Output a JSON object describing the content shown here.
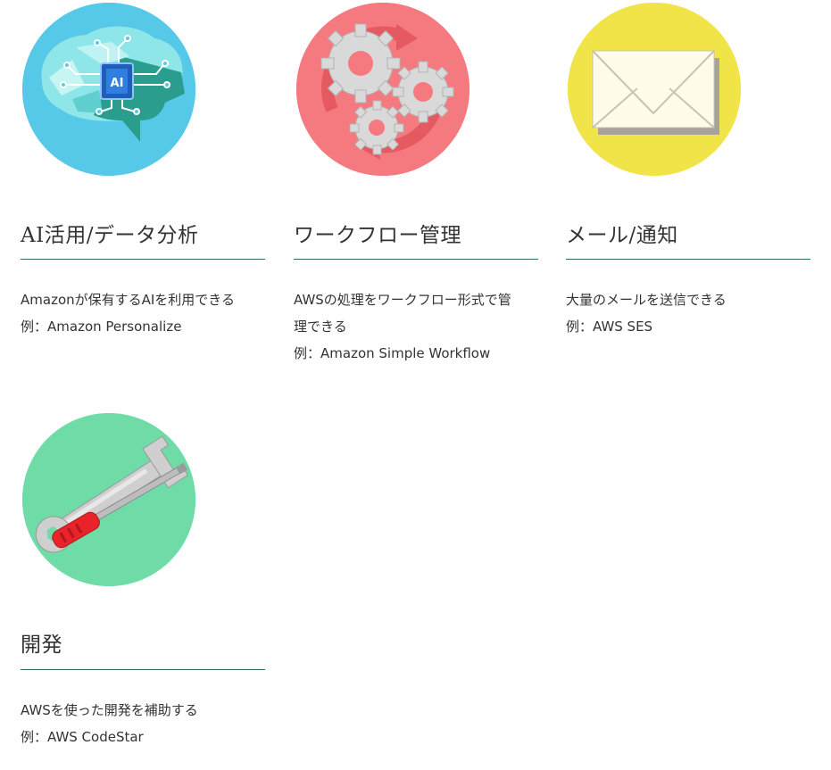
{
  "cards": [
    {
      "title": "AI活用/データ分析",
      "desc1": "Amazonが保有するAIを利用できる",
      "example": "例：Amazon Personalize",
      "icon": "ai-brain-icon",
      "color": "#56c9e8"
    },
    {
      "title": "ワークフロー管理",
      "desc1": "AWSの処理をワークフロー形式で管",
      "desc2": "理できる",
      "example": "例：Amazon Simple Workflow",
      "icon": "gears-icon",
      "color": "#f57a7f"
    },
    {
      "title": "メール/通知",
      "desc1": "大量のメールを送信できる",
      "example": "例：AWS SES",
      "icon": "envelope-icon",
      "color": "#f0e449"
    },
    {
      "title": "開発",
      "desc1": "AWSを使った開発を補助する",
      "example": "例：AWS CodeStar",
      "icon": "tools-icon",
      "color": "#6fdca8"
    }
  ],
  "colors": {
    "rule": "#2d6e6a",
    "text": "#333333"
  }
}
